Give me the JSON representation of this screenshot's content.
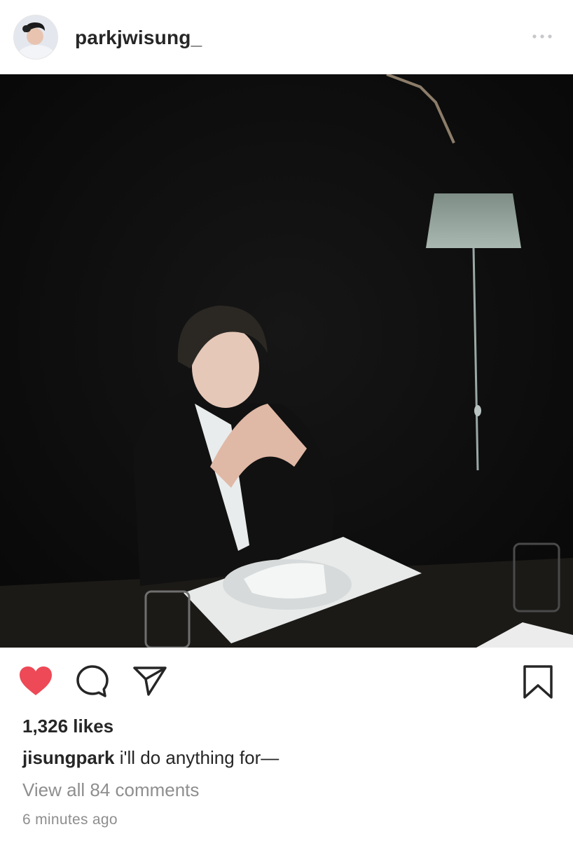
{
  "post": {
    "username": "parkjwisung_",
    "likes_text": "1,326 likes",
    "caption_user": "jisungpark",
    "caption_text": "i'll do anything for—",
    "comments_text": "View all 84 comments",
    "timestamp": "6 minutes ago"
  },
  "icons": {
    "more": "more-horizontal-icon",
    "like": "heart-filled-icon",
    "comment": "comment-bubble-icon",
    "share": "paper-plane-icon",
    "save": "bookmark-icon"
  },
  "colors": {
    "like_red": "#ed4956",
    "text_primary": "#262626",
    "text_secondary": "#8e8e8e"
  }
}
